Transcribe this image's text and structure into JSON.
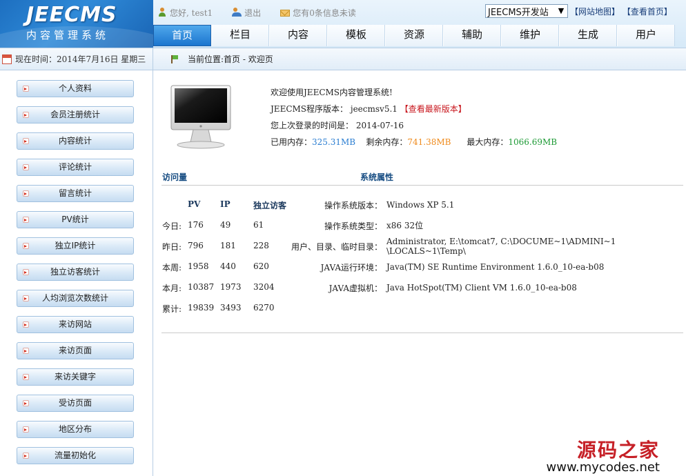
{
  "logo": {
    "title": "JEECMS",
    "subtitle": "内容管理系统"
  },
  "topbar": {
    "greeting": "您好, test1",
    "logout": "退出",
    "messages": "您有0条信息未读"
  },
  "site_select": {
    "value": "JEECMS开发站"
  },
  "top_links": {
    "sitemap": "【网站地图】",
    "view_home": "【查看首页】"
  },
  "nav": {
    "tabs": [
      {
        "label": "首页",
        "active": true
      },
      {
        "label": "栏目"
      },
      {
        "label": "内容"
      },
      {
        "label": "模板"
      },
      {
        "label": "资源"
      },
      {
        "label": "辅助"
      },
      {
        "label": "维护"
      },
      {
        "label": "生成"
      },
      {
        "label": "用户"
      }
    ]
  },
  "subbar": {
    "time_label": "现在时间：",
    "time_value": "2014年7月16日 星期三",
    "location_label": "当前位置: ",
    "location_value": "首页 - 欢迎页"
  },
  "sidebar": {
    "items": [
      "个人资料",
      "会员注册统计",
      "内容统计",
      "评论统计",
      "留言统计",
      "PV统计",
      "独立IP统计",
      "独立访客统计",
      "人均浏览次数统计",
      "来访网站",
      "来访页面",
      "来访关键字",
      "受访页面",
      "地区分布",
      "流量初始化"
    ]
  },
  "info": {
    "welcome": "欢迎使用JEECMS内容管理系统!",
    "version_label": "JEECMS程序版本：",
    "version_value": "jeecmsv5.1",
    "check_latest": "【查看最新版本】",
    "last_login_label": "您上次登录的时间是：",
    "last_login_value": "2014-07-16",
    "used_mem_label": "已用内存：",
    "used_mem_value": "325.31MB",
    "free_mem_label": "剩余内存：",
    "free_mem_value": "741.38MB",
    "max_mem_label": "最大内存：",
    "max_mem_value": "1066.69MB"
  },
  "sections": {
    "visits": "访问量",
    "system": "系统属性"
  },
  "visits": {
    "headers": [
      "PV",
      "IP",
      "独立访客"
    ],
    "rows": [
      {
        "label": "今日:",
        "pv": "176",
        "ip": "49",
        "uv": "61"
      },
      {
        "label": "昨日:",
        "pv": "796",
        "ip": "181",
        "uv": "228"
      },
      {
        "label": "本周:",
        "pv": "1958",
        "ip": "440",
        "uv": "620"
      },
      {
        "label": "本月:",
        "pv": "10387",
        "ip": "1973",
        "uv": "3204"
      },
      {
        "label": "累计:",
        "pv": "19839",
        "ip": "3493",
        "uv": "6270"
      }
    ]
  },
  "system": {
    "rows": [
      {
        "label": "操作系统版本：",
        "value": "Windows XP 5.1"
      },
      {
        "label": "操作系统类型：",
        "value": "x86 32位"
      },
      {
        "label": "用户、目录、临时目录：",
        "value": "Administrator, E:\\tomcat7, C:\\DOCUME~1\\ADMINI~1",
        "value2": "\\LOCALS~1\\Temp\\"
      },
      {
        "label": "JAVA运行环境：",
        "value": "Java(TM) SE Runtime Environment 1.6.0_10-ea-b08"
      },
      {
        "label": "JAVA虚拟机：",
        "value": "Java HotSpot(TM) Client VM 1.6.0_10-ea-b08"
      }
    ]
  },
  "watermark": {
    "cn": "源码之家",
    "url": "www.mycodes.net"
  }
}
